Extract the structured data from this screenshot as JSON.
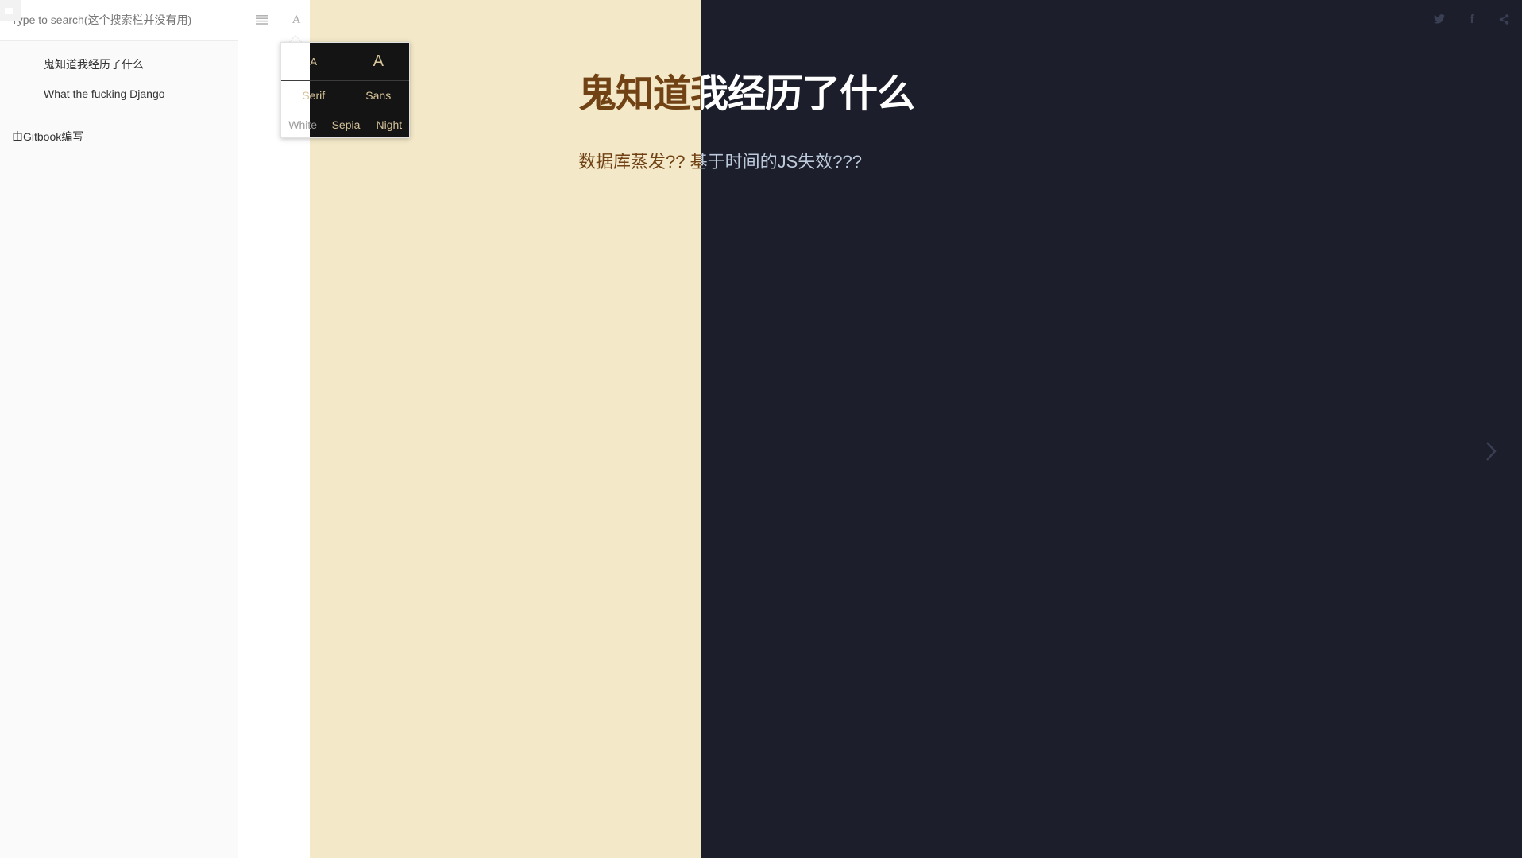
{
  "search": {
    "placeholder": "Type to search(这个搜索栏并没有用)"
  },
  "sidebar": {
    "items": [
      {
        "label": "鬼知道我经历了什么"
      },
      {
        "label": "What the fucking Django"
      }
    ],
    "powered_by": "由Gitbook编写"
  },
  "toolbar": {
    "menu_icon": "menu-lines-icon",
    "font_icon_label": "A"
  },
  "font_settings": {
    "size_small": "A",
    "size_large": "A",
    "family_serif": "Serif",
    "family_sans": "Sans",
    "theme_white": "White",
    "theme_sepia": "Sepia",
    "theme_night": "Night"
  },
  "page": {
    "title": "鬼知道我经历了什么",
    "text": "数据库蒸发?? 基于时间的JS失效???"
  },
  "header_icons": {
    "twitter": "twitter-icon",
    "facebook": "f",
    "share": "share-icon"
  },
  "nav": {
    "next": "chevron-right-icon"
  },
  "colors": {
    "sepia_bg": "#f3e8c8",
    "night_bg": "#1c1f2b",
    "sepia_text": "#704214",
    "night_title": "#ffffff",
    "night_text": "#bdcadb",
    "sidebar_bg": "#fafafa"
  }
}
